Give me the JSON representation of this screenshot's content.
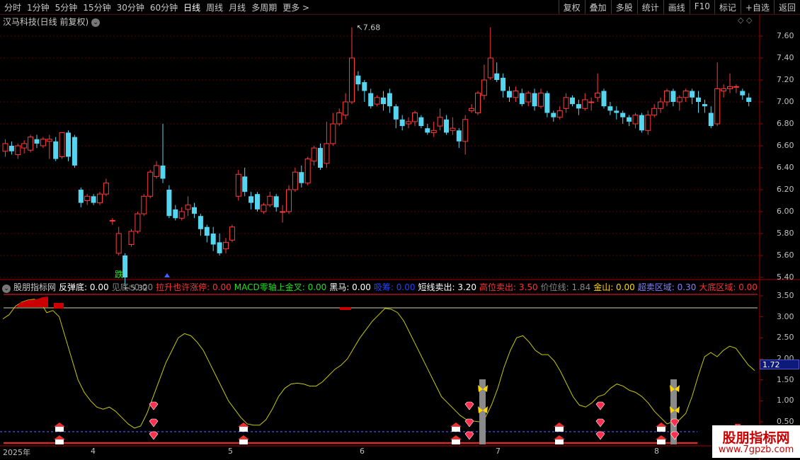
{
  "toolbar": {
    "periods": [
      "分时",
      "1分钟",
      "5分钟",
      "15分钟",
      "30分钟",
      "60分钟",
      "日线",
      "周线",
      "月线",
      "多周期",
      "更多 >"
    ],
    "active_period": "日线",
    "actions": [
      "复权",
      "叠加",
      "多股",
      "统计",
      "画线",
      "F10",
      "标记",
      "+自选",
      "返回"
    ]
  },
  "stock_title": "汉马科技(日线 前复权)",
  "top_icons": "◇ ◇",
  "price_axis": [
    "7.60",
    "7.40",
    "7.20",
    "7.00",
    "6.80",
    "6.60",
    "6.40",
    "6.20",
    "6.00",
    "5.80",
    "5.60",
    "5.40"
  ],
  "annotations": {
    "high": "7.68",
    "low": "5.32",
    "marker": "跌"
  },
  "indicator_axis": [
    "3.50",
    "3.00",
    "2.50",
    "2.00",
    "1.50",
    "1.00",
    "0.50"
  ],
  "indicator_value_badge": "1.72",
  "indicator_header": [
    {
      "text": "股朋指标网",
      "color": "#c8c8c8"
    },
    {
      "text": "反弹底: 0.00",
      "color": "#ffffff"
    },
    {
      "text": "见底: 0.00",
      "color": "#888888"
    },
    {
      "text": "拉升也许涨停: 0.00",
      "color": "#ff3030"
    },
    {
      "text": "MACD零轴上金叉: 0.00",
      "color": "#22dd22"
    },
    {
      "text": "黑马: 0.00",
      "color": "#ffffff"
    },
    {
      "text": "吸筹: 0.00",
      "color": "#2244ff"
    },
    {
      "text": "短线卖出: 3.20",
      "color": "#ffffff"
    },
    {
      "text": "高位卖出: 3.50",
      "color": "#ff3030"
    },
    {
      "text": "价位线: 1.84",
      "color": "#888888"
    },
    {
      "text": "金山: 0.00",
      "color": "#ffd700"
    },
    {
      "text": "超卖区域: 0.30",
      "color": "#8080ff"
    },
    {
      "text": "大底区域: 0.00",
      "color": "#ff3030"
    }
  ],
  "date_axis": [
    "2025年",
    "4",
    "5",
    "6",
    "7",
    "8"
  ],
  "watermark": {
    "line1": "股朋指标网",
    "line2": "www.7gpzb.com"
  },
  "colors": {
    "up": "#ff3b3b",
    "down": "#54d6f0",
    "grid": "#5a0000",
    "yellow": "#c8c800"
  }
}
